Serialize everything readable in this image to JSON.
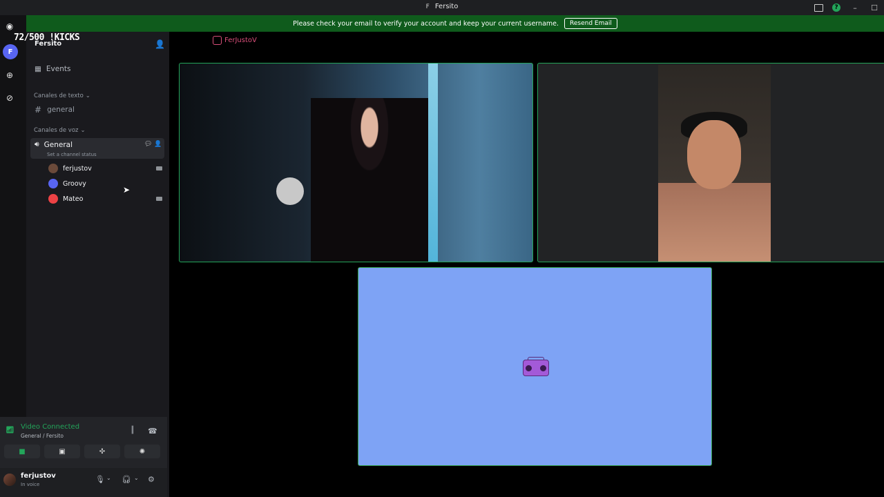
{
  "window": {
    "title": "Fersito",
    "title_prefix": "F"
  },
  "banner": {
    "text": "Please check your email to verify your account and keep your current username.",
    "button": "Resend Email"
  },
  "overlay": {
    "counter": "72/500 !KICKS",
    "instagram": "FerJustoV"
  },
  "rail": {
    "server_initial": "F"
  },
  "sidebar": {
    "server_name": "Fersito",
    "events_label": "Events",
    "text_category": "Canales de texto",
    "text_channel": "general",
    "voice_category": "Canales de voz",
    "voice_channel": "General",
    "channel_status": "Set a channel status",
    "members": [
      {
        "name": "ferjustov",
        "color": "#6b4a3a"
      },
      {
        "name": "Groovy",
        "color": "#5865f2"
      },
      {
        "name": "Mateo",
        "color": "#ed4245"
      }
    ]
  },
  "voice_panel": {
    "status": "Video Connected",
    "location": "General / Fersito"
  },
  "user": {
    "name": "ferjustov",
    "status": "In voice"
  }
}
